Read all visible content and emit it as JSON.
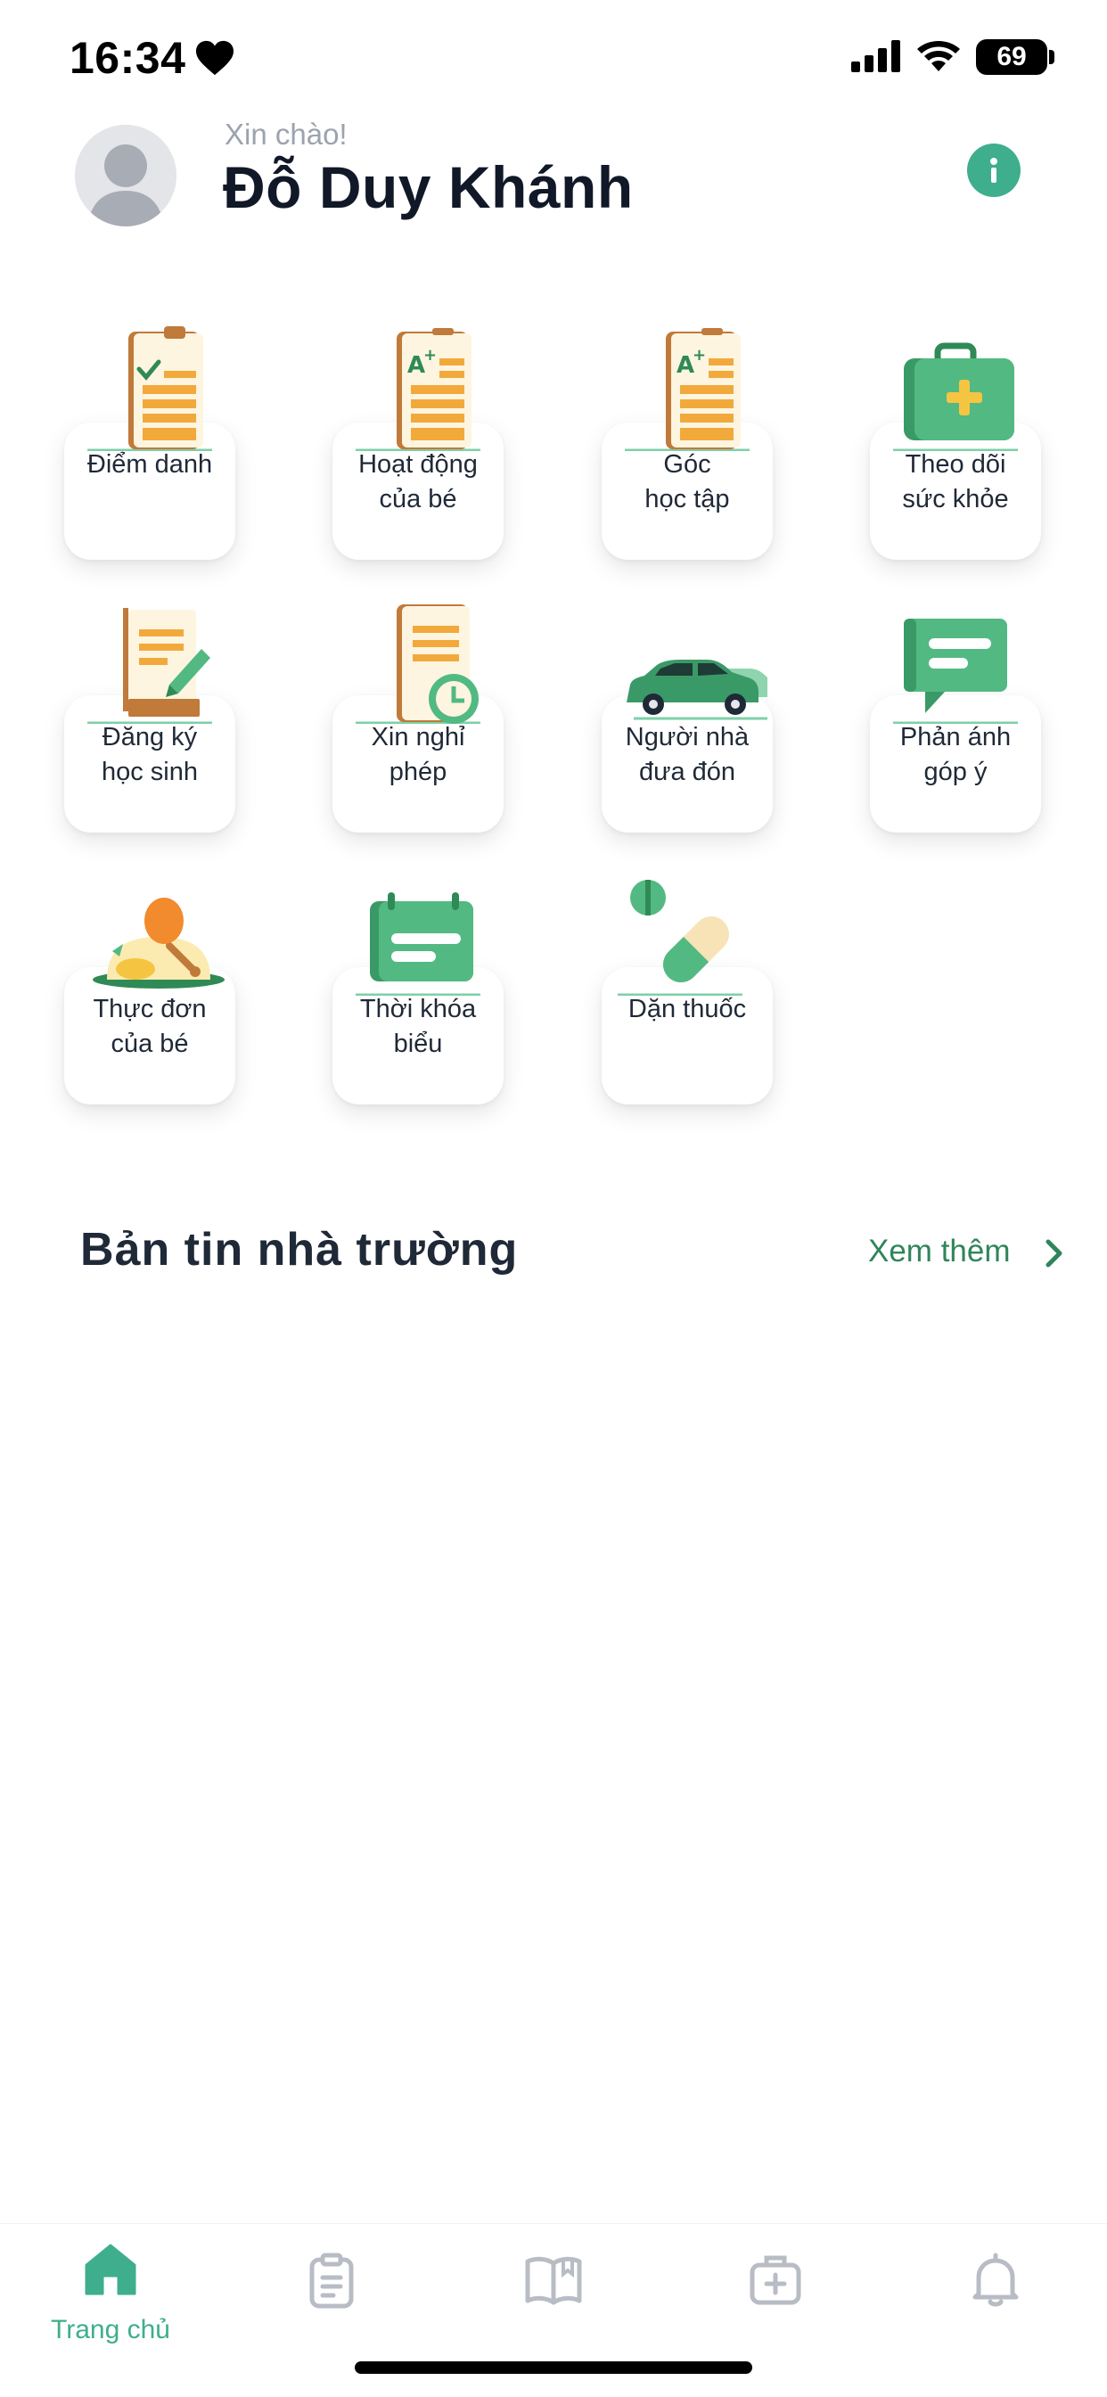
{
  "status_bar": {
    "time": "16:34",
    "battery": "69"
  },
  "header": {
    "greeting": "Xin chào!",
    "user_name": "Đỗ Duy Khánh"
  },
  "features": [
    {
      "label_line1": "Điểm danh",
      "label_line2": "",
      "icon": "attendance-clipboard-icon"
    },
    {
      "label_line1": "Hoạt động",
      "label_line2": "của bé",
      "icon": "activity-report-icon"
    },
    {
      "label_line1": "Góc",
      "label_line2": "học tập",
      "icon": "learning-report-icon"
    },
    {
      "label_line1": "Theo dõi",
      "label_line2": "sức khỏe",
      "icon": "medical-kit-icon"
    },
    {
      "label_line1": "Đăng ký",
      "label_line2": "học sinh",
      "icon": "register-form-icon"
    },
    {
      "label_line1": "Xin nghỉ",
      "label_line2": "phép",
      "icon": "leave-request-icon"
    },
    {
      "label_line1": "Người nhà",
      "label_line2": "đưa đón",
      "icon": "car-pickup-icon"
    },
    {
      "label_line1": "Phản ánh",
      "label_line2": "góp ý",
      "icon": "feedback-chat-icon"
    },
    {
      "label_line1": "Thực đơn",
      "label_line2": "của bé",
      "icon": "menu-food-icon"
    },
    {
      "label_line1": "Thời khóa",
      "label_line2": "biểu",
      "icon": "timetable-icon"
    },
    {
      "label_line1": "Dặn thuốc",
      "label_line2": "",
      "icon": "medicine-pill-icon"
    }
  ],
  "news": {
    "title": "Bản tin nhà trường",
    "see_more": "Xem thêm"
  },
  "bottom_nav": [
    {
      "label": "Trang chủ",
      "icon": "home-icon",
      "active": true
    },
    {
      "label": "",
      "icon": "clipboard-icon",
      "active": false
    },
    {
      "label": "",
      "icon": "book-icon",
      "active": false
    },
    {
      "label": "",
      "icon": "medical-bag-icon",
      "active": false
    },
    {
      "label": "",
      "icon": "bell-icon",
      "active": false
    }
  ],
  "colors": {
    "primary": "#3fae8d",
    "accent_green": "#2f855a",
    "icon_orange": "#f2a93b",
    "icon_brown": "#c07a3a"
  }
}
